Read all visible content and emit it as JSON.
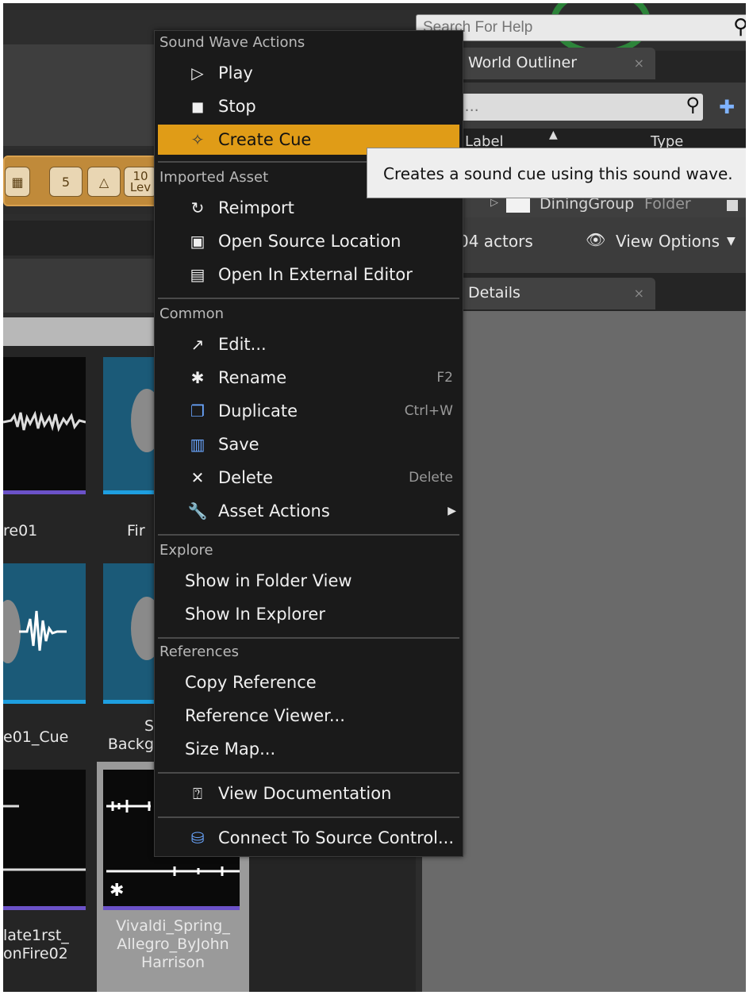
{
  "help_search": {
    "placeholder": "Search For Help"
  },
  "mode_bar": {
    "grid_value": "5",
    "angle_value": "10",
    "level_label": "Lev"
  },
  "world_outliner": {
    "tab_label": "World Outliner",
    "search_placeholder": "arch...",
    "col_label": "Label",
    "col_type": "Type",
    "folder_row": {
      "name": "DiningGroup",
      "type": "Folder"
    },
    "actor_count": "04 actors",
    "view_options": "View Options"
  },
  "details": {
    "tab_label": "Details"
  },
  "content_browser": {
    "tiles": [
      {
        "label": "re01"
      },
      {
        "label": "Fir"
      },
      {
        "label": "e01_Cue"
      },
      {
        "label_line1": "S",
        "label_line2": "Backg"
      },
      {
        "label_line1": "late1rst_",
        "label_line2": "onFire02"
      },
      {
        "label_line1": "Vivaldi_Spring_",
        "label_line2": "Allegro_ByJohn",
        "label_line3": "Harrison"
      }
    ]
  },
  "context_menu": {
    "sections": {
      "sound_wave_actions": "Sound Wave Actions",
      "imported_asset": "Imported Asset",
      "common": "Common",
      "explore": "Explore",
      "references": "References"
    },
    "items": {
      "play": "Play",
      "stop": "Stop",
      "create_cue": "Create Cue",
      "reimport": "Reimport",
      "open_source_location": "Open Source Location",
      "open_in_external_editor": "Open In External Editor",
      "edit": "Edit...",
      "rename": "Rename",
      "rename_shortcut": "F2",
      "duplicate": "Duplicate",
      "duplicate_shortcut": "Ctrl+W",
      "save": "Save",
      "delete": "Delete",
      "delete_shortcut": "Delete",
      "asset_actions": "Asset Actions",
      "show_in_folder_view": "Show in Folder View",
      "show_in_explorer": "Show In Explorer",
      "copy_reference": "Copy Reference",
      "reference_viewer": "Reference Viewer...",
      "size_map": "Size Map...",
      "view_documentation": "View Documentation",
      "connect_to_source_control": "Connect To Source Control..."
    },
    "highlighted_item": "create_cue",
    "highlight_color": "#e09c17"
  },
  "tooltip": {
    "text": "Creates a sound cue using this sound wave."
  }
}
